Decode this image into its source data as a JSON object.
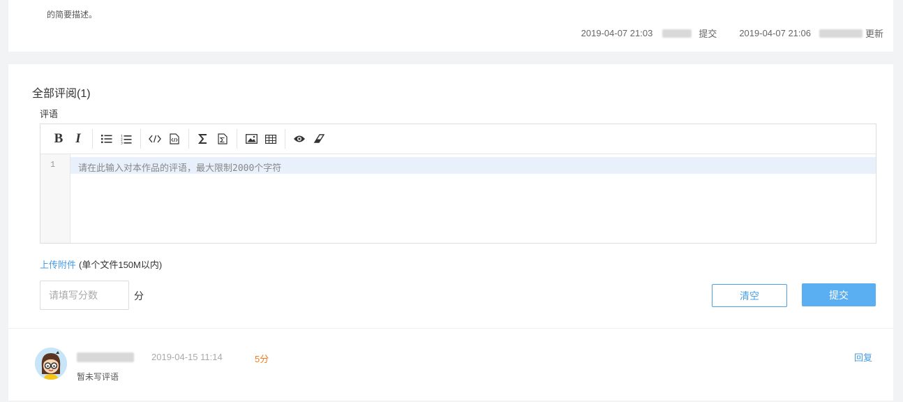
{
  "work": {
    "desc_tail": "的简要描述。",
    "submit_time": "2019-04-07 21:03",
    "submit_label": "提交",
    "update_time": "2019-04-07 21:06",
    "update_label": "更新"
  },
  "review": {
    "title": "全部评阅(1)",
    "comment_label": "评语",
    "toolbar": {
      "groups": [
        [
          "bold-icon",
          "italic-icon"
        ],
        [
          "unordered-list-icon",
          "ordered-list-icon"
        ],
        [
          "code-icon",
          "code-block-icon"
        ],
        [
          "formula-icon",
          "formula-block-icon"
        ],
        [
          "image-icon",
          "table-icon"
        ],
        [
          "preview-icon",
          "eraser-icon"
        ]
      ]
    },
    "editor": {
      "line_number": "1",
      "placeholder": "请在此输入对本作品的评语，最大限制2000个字符"
    },
    "upload_link": "上传附件",
    "upload_note": "(单个文件150M以内)",
    "score_placeholder": "请填写分数",
    "score_unit": "分",
    "clear_label": "清空",
    "submit_label": "提交"
  },
  "comments": [
    {
      "time": "2019-04-15 11:14",
      "score": "5分",
      "text": "暂未写评语",
      "reply_label": "回复"
    }
  ],
  "colors": {
    "accent": "#459be5",
    "score": "#f37b1d"
  }
}
